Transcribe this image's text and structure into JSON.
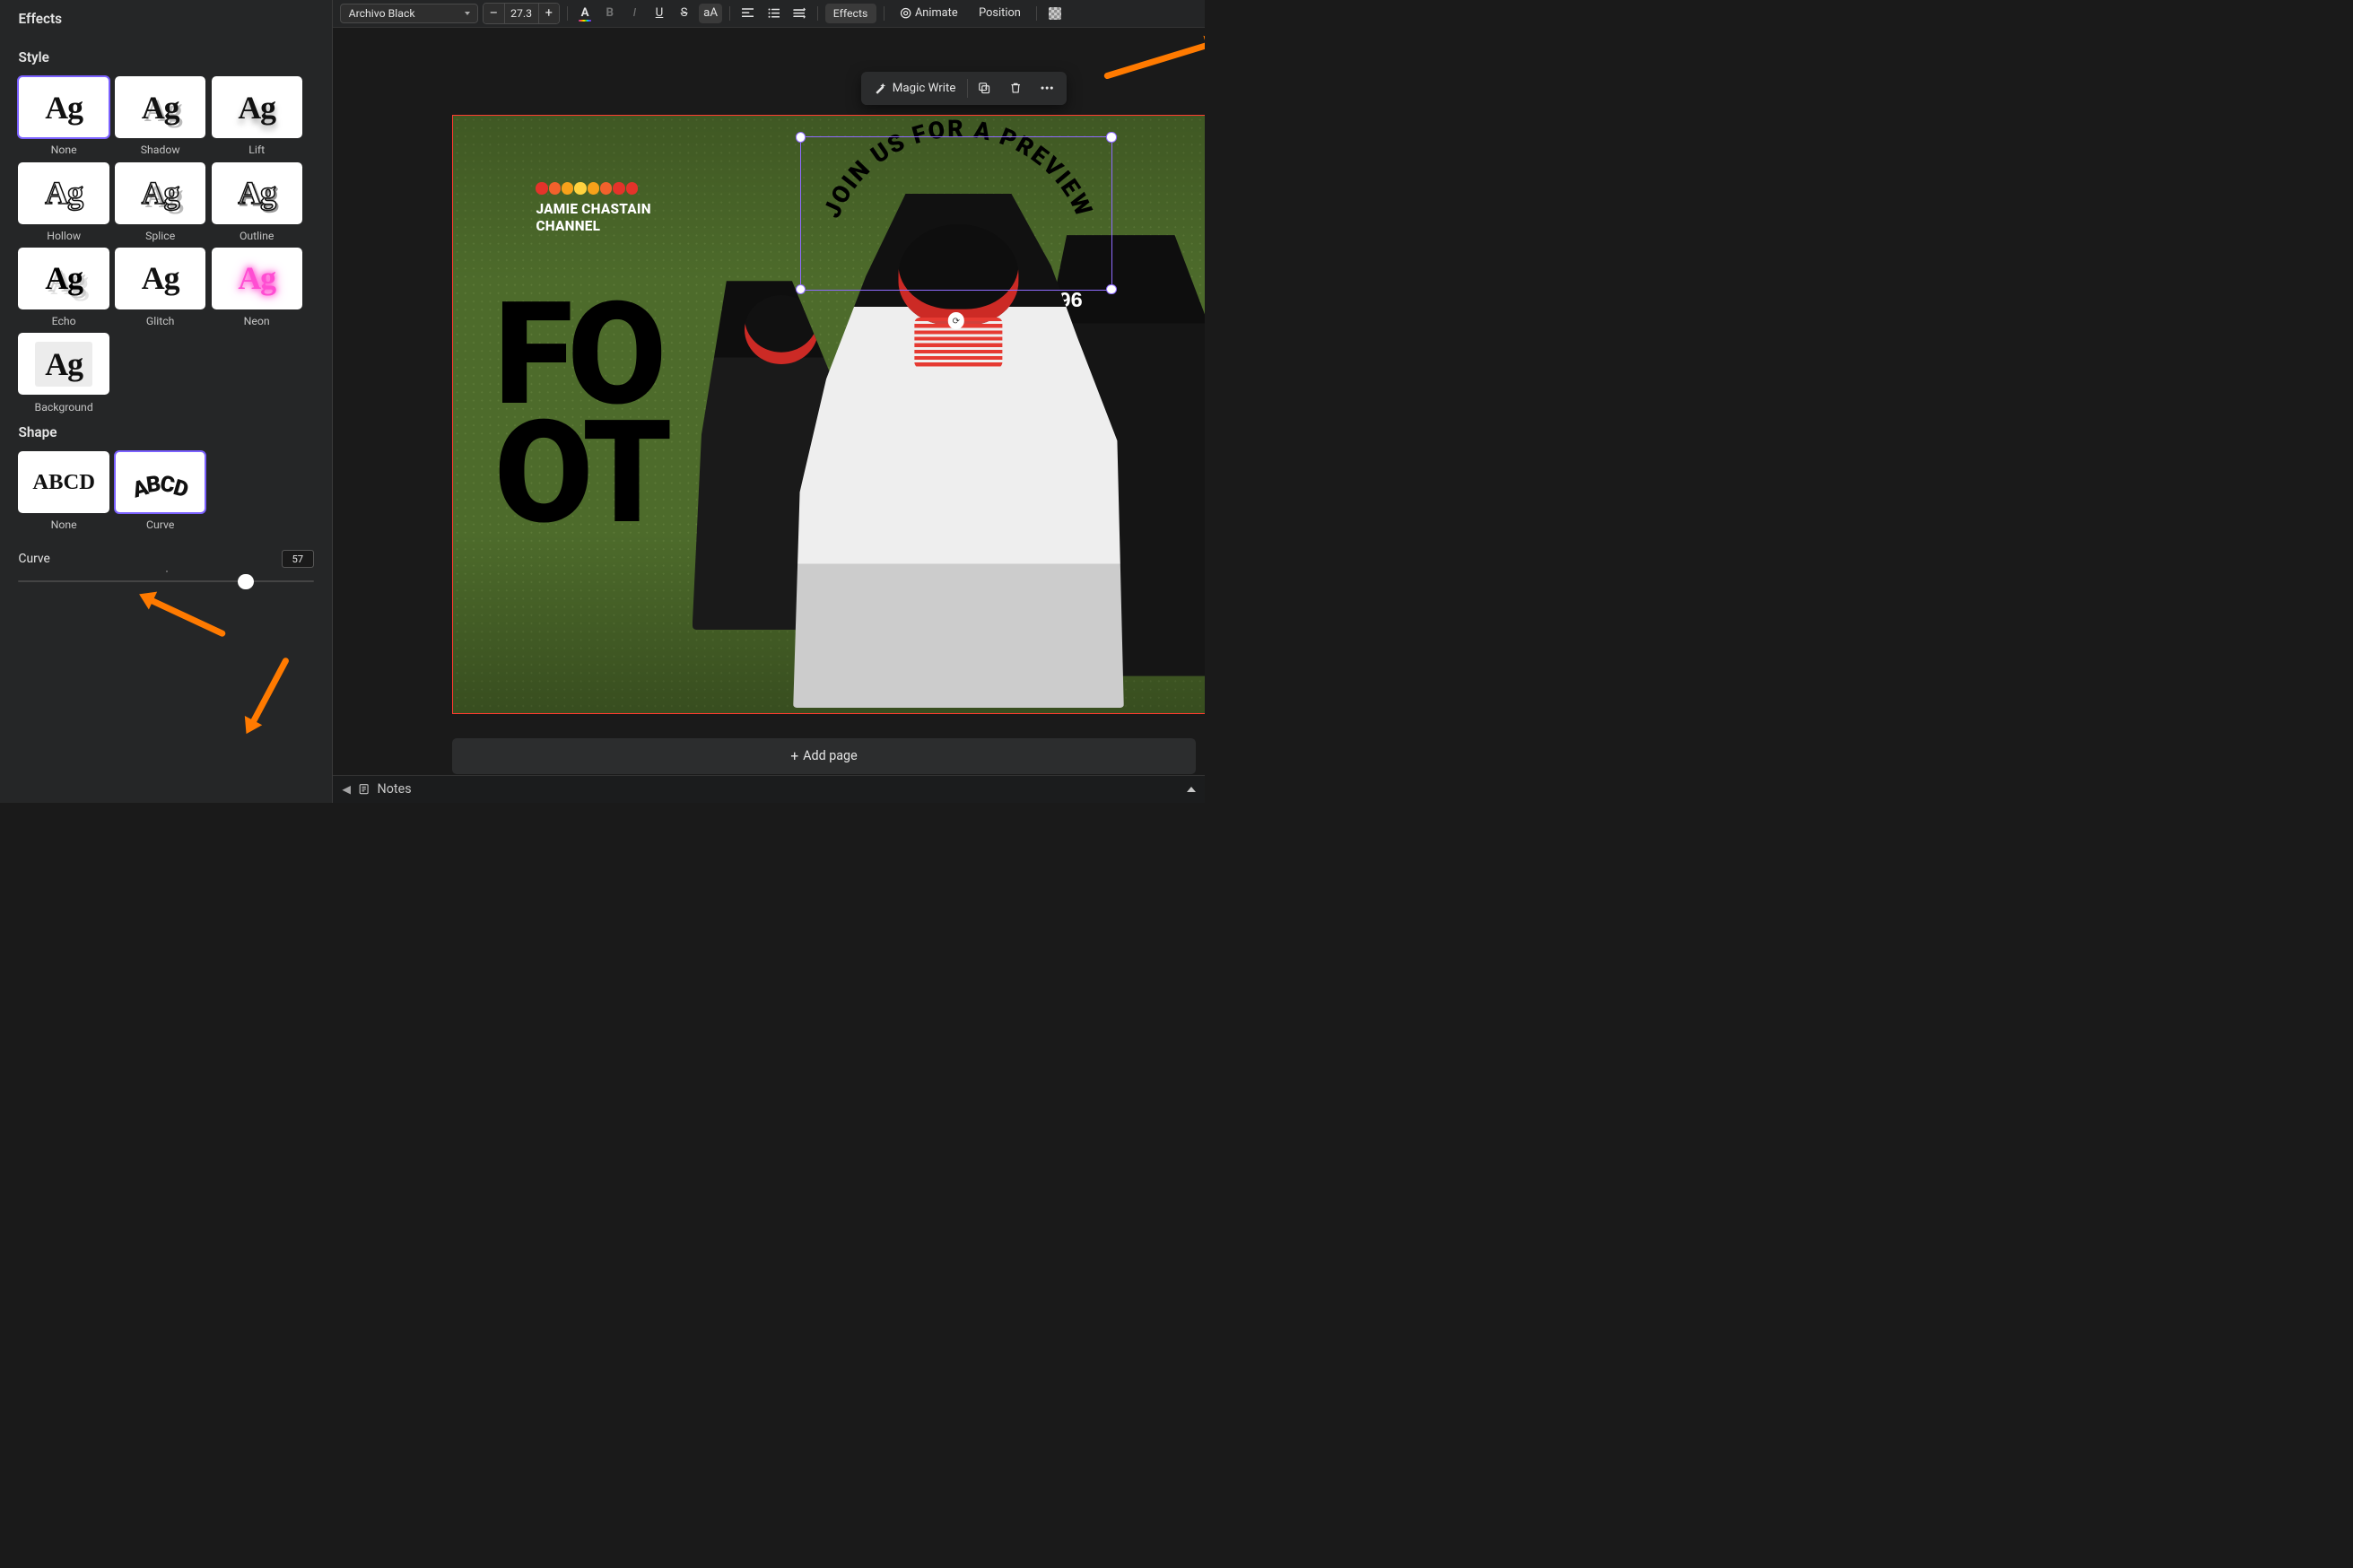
{
  "panel": {
    "title": "Effects",
    "style": {
      "label": "Style",
      "items": [
        {
          "label": "None",
          "variant": "none",
          "selected": true
        },
        {
          "label": "Shadow",
          "variant": "shadow"
        },
        {
          "label": "Lift",
          "variant": "lift"
        },
        {
          "label": "Hollow",
          "variant": "hollow"
        },
        {
          "label": "Splice",
          "variant": "splice"
        },
        {
          "label": "Outline",
          "variant": "outline"
        },
        {
          "label": "Echo",
          "variant": "echo"
        },
        {
          "label": "Glitch",
          "variant": "glitch"
        },
        {
          "label": "Neon",
          "variant": "neon"
        },
        {
          "label": "Background",
          "variant": "background"
        }
      ]
    },
    "shape": {
      "label": "Shape",
      "items": [
        {
          "label": "None",
          "variant": "straight"
        },
        {
          "label": "Curve",
          "variant": "curve",
          "selected": true
        }
      ]
    },
    "curve": {
      "label": "Curve",
      "value": "57"
    }
  },
  "toolbar": {
    "font": "Archivo Black",
    "size": "27.3",
    "effects": "Effects",
    "animate": "Animate",
    "position": "Position"
  },
  "context": {
    "magic": "Magic Write"
  },
  "canvas": {
    "channel_line1": "JAMIE CHASTAIN",
    "channel_line2": "CHANNEL",
    "big_line1": "FO",
    "big_line2": "OT",
    "curved_text": "JOIN US FOR A PREVIEW"
  },
  "footer": {
    "add_page": "Add page",
    "notes": "Notes"
  }
}
